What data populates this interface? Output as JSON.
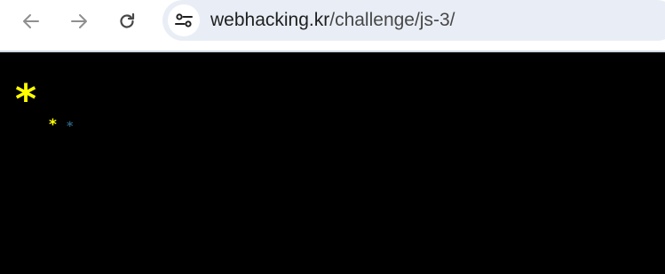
{
  "browser": {
    "back_icon": "back-arrow-icon",
    "forward_icon": "forward-arrow-icon",
    "reload_icon": "reload-icon",
    "site_info_icon": "tune-icon",
    "address": {
      "host": "webhacking.kr",
      "path": "/challenge/js-3/"
    },
    "colors": {
      "toolbar": "#ffffff",
      "omnibox": "#e9eef6",
      "icon_disabled": "#8f8f8f",
      "icon_active": "#474747"
    }
  },
  "page": {
    "background": "#000000",
    "stars": [
      {
        "glyph": "*",
        "color": "#ffff00"
      },
      {
        "glyph": "*",
        "color": "#ffff00"
      },
      {
        "glyph": "*",
        "color": "#2a5f7a"
      }
    ]
  }
}
